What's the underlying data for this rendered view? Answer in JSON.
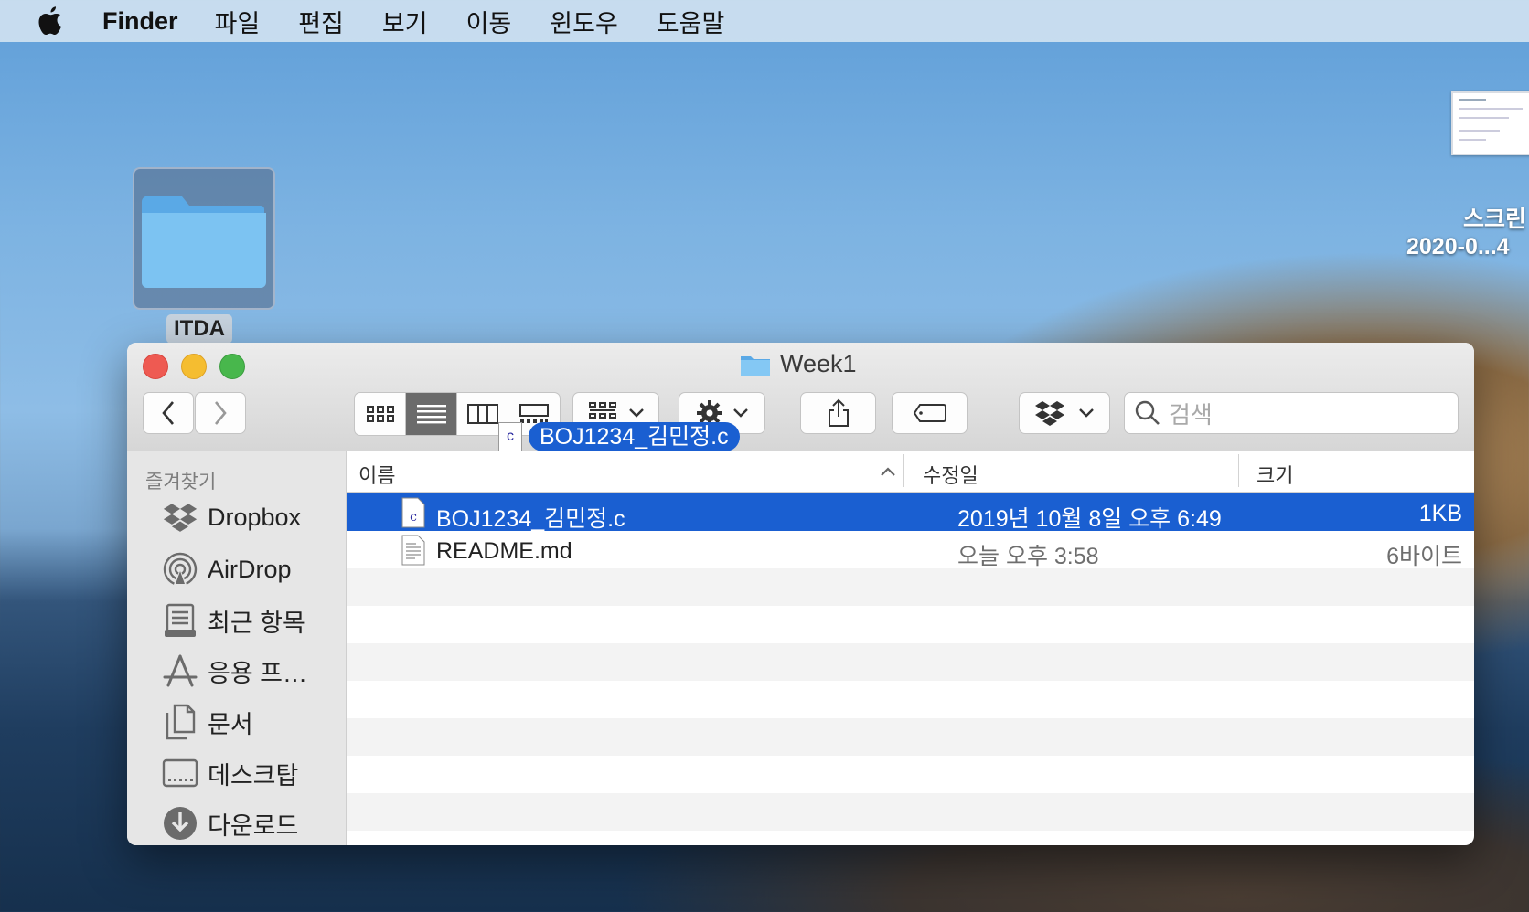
{
  "menubar": {
    "app_name": "Finder",
    "items": [
      "파일",
      "편집",
      "보기",
      "이동",
      "윈도우",
      "도움말"
    ]
  },
  "desktop": {
    "folder_label": "ITDA",
    "screenshot_label_line1": "스크린",
    "screenshot_label_line2": "2020-0...4"
  },
  "window": {
    "title": "Week1",
    "search_placeholder": "검색",
    "drag_label": "BOJ1234_김민정.c",
    "drag_icon_letter": "c"
  },
  "sidebar": {
    "heading": "즐겨찾기",
    "items": [
      {
        "label": "Dropbox",
        "icon": "dropbox-icon"
      },
      {
        "label": "AirDrop",
        "icon": "airdrop-icon"
      },
      {
        "label": "최근 항목",
        "icon": "recents-icon"
      },
      {
        "label": "응용 프…",
        "icon": "applications-icon"
      },
      {
        "label": "문서",
        "icon": "documents-icon"
      },
      {
        "label": "데스크탑",
        "icon": "desktop-icon"
      },
      {
        "label": "다운로드",
        "icon": "downloads-icon"
      }
    ]
  },
  "list": {
    "columns": {
      "name": "이름",
      "modified": "수정일",
      "size": "크기"
    },
    "files": [
      {
        "name": "BOJ1234_김민정.c",
        "modified": "2019년 10월 8일 오후 6:49",
        "size": "1KB",
        "selected": true,
        "icon_letter": "c"
      },
      {
        "name": "README.md",
        "modified": "오늘 오후 3:58",
        "size": "6바이트",
        "selected": false
      }
    ]
  },
  "colors": {
    "selection": "#1a5fd1",
    "close": "#ee5a52",
    "minimize": "#f5bd30",
    "zoom": "#48b74c"
  }
}
